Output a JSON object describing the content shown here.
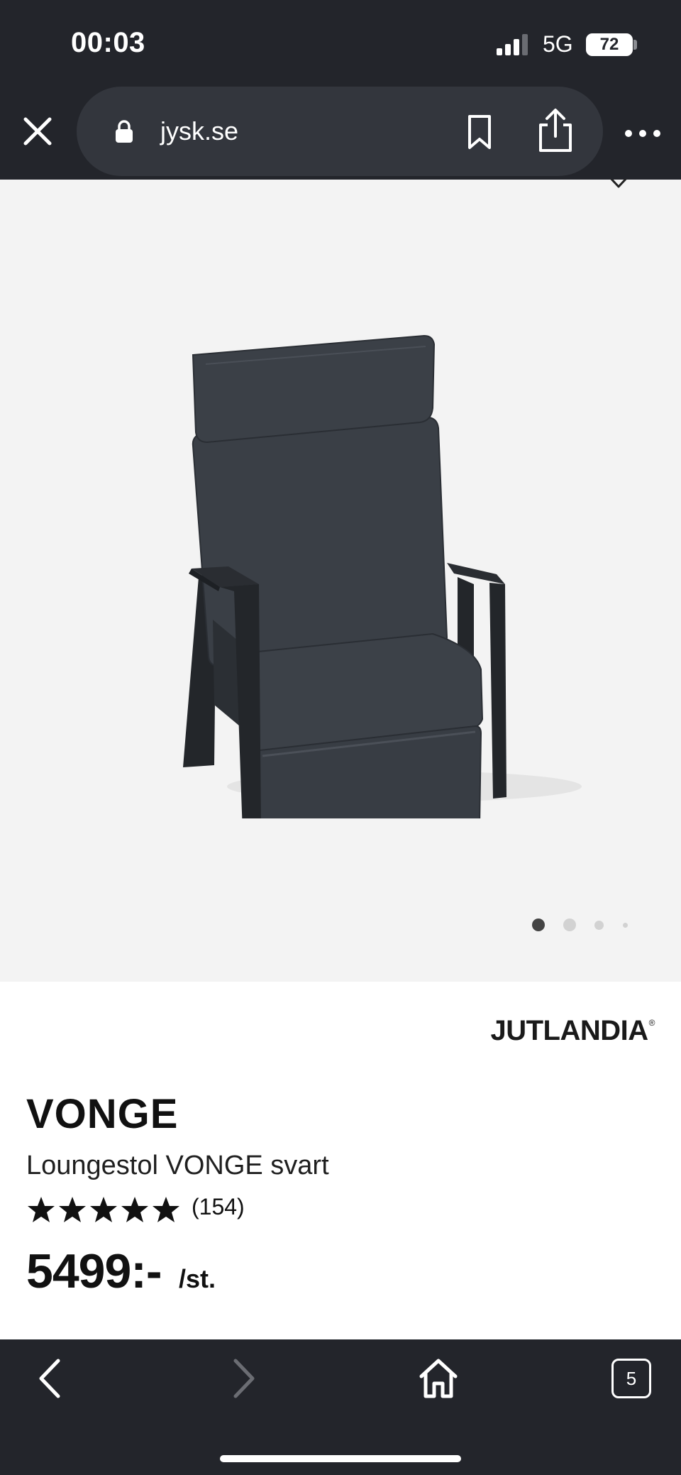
{
  "status_bar": {
    "time": "00:03",
    "network": "5G",
    "battery": "72"
  },
  "browser": {
    "url": "jysk.se",
    "tab_count": "5"
  },
  "product": {
    "brand": "JUTLANDIA",
    "brand_mark": "®",
    "name": "VONGE",
    "description": "Loungestol VONGE svart",
    "rating_stars": 5,
    "rating_count": "(154)",
    "price": "5499:-",
    "price_unit": "/st."
  },
  "carousel": {
    "image_count": 4,
    "active_index": 0
  },
  "colors": {
    "browser_chrome": "#23252b",
    "address_bar": "#33363d",
    "image_background": "#f3f3f3",
    "chair_fabric": "#3a3f46",
    "chair_frame": "#23262a"
  }
}
